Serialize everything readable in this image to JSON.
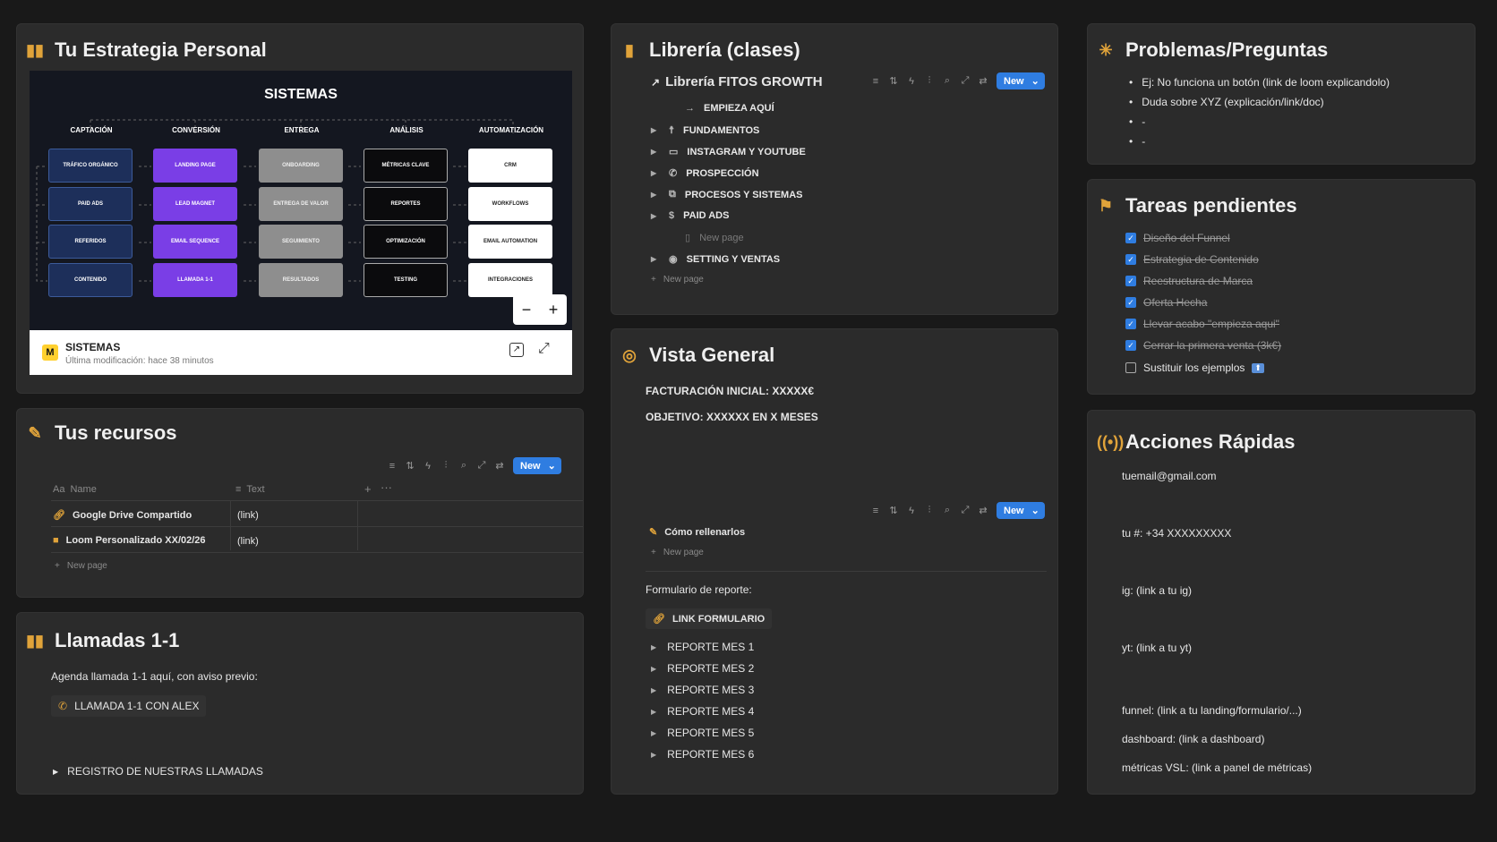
{
  "estrategia": {
    "title": "Tu Estrategia Personal",
    "diagram": {
      "title": "SISTEMAS",
      "columns": [
        "CAPTACIÓN",
        "CONVERSIÓN",
        "ENTREGA",
        "ANÁLISIS",
        "AUTOMATIZACIÓN"
      ],
      "boxes": [
        [
          "TRÁFICO ORGÁNICO",
          "PAID ADS",
          "REFERIDOS",
          "CONTENIDO"
        ],
        [
          "LANDING PAGE",
          "LEAD MAGNET",
          "EMAIL SEQUENCE",
          "LLAMADA 1-1"
        ],
        [
          "ONBOARDING",
          "ENTREGA DE VALOR",
          "SEGUIMIENTO",
          "RESULTADOS"
        ],
        [
          "MÉTRICAS CLAVE",
          "REPORTES",
          "OPTIMIZACIÓN",
          "TESTING"
        ],
        [
          "CRM",
          "WORKFLOWS",
          "EMAIL AUTOMATION",
          "INTEGRACIONES"
        ]
      ],
      "zoom_out": "−",
      "zoom_in": "+"
    },
    "footer": {
      "name": "SISTEMAS",
      "modified": "Última modificación: hace 38 minutos"
    }
  },
  "recursos": {
    "title": "Tus recursos",
    "new_label": "New",
    "col_name": "Name",
    "col_text": "Text",
    "rows": [
      {
        "name": "Google Drive Compartido",
        "text": "(link)"
      },
      {
        "name": "Loom Personalizado XX/02/26",
        "text": "(link)"
      }
    ],
    "new_page": "New page"
  },
  "llamadas": {
    "title": "Llamadas 1-1",
    "intro": "Agenda llamada 1-1 aquí, con aviso previo:",
    "button": "LLAMADA 1-1 CON ALEX",
    "toggle": "REGISTRO DE NUESTRAS LLAMADAS"
  },
  "libreria": {
    "title": "Librería (clases)",
    "db_title": "Librería FITOS GROWTH",
    "new_label": "New",
    "items": [
      {
        "label": "EMPIEZA AQUÍ",
        "toggle": false
      },
      {
        "label": "FUNDAMENTOS",
        "toggle": true
      },
      {
        "label": "INSTAGRAM Y YOUTUBE",
        "toggle": true
      },
      {
        "label": "PROSPECCIÓN",
        "toggle": true
      },
      {
        "label": "PROCESOS Y SISTEMAS",
        "toggle": true
      },
      {
        "label": "PAID ADS",
        "toggle": true
      }
    ],
    "new_page_inner": "New page",
    "item_last": "SETTING Y VENTAS",
    "new_page": "New page"
  },
  "vista": {
    "title": "Vista General",
    "facturacion": "FACTURACIÓN INICIAL: XXXXX€",
    "objetivo": "OBJETIVO: XXXXXX EN X MESES",
    "new_label": "New",
    "como": "Cómo rellenarlos",
    "new_page": "New page",
    "formulario_label": "Formulario de reporte:",
    "link_formulario": "LINK FORMULARIO",
    "reportes": [
      "REPORTE MES 1",
      "REPORTE MES 2",
      "REPORTE MES 3",
      "REPORTE MES 4",
      "REPORTE MES 5",
      "REPORTE MES 6"
    ]
  },
  "problemas": {
    "title": "Problemas/Preguntas",
    "bullets": [
      "Ej: No funciona un botón (link de loom explicandolo)",
      "Duda sobre XYZ (explicación/link/doc)",
      "-",
      "-"
    ]
  },
  "tareas": {
    "title": "Tareas pendientes",
    "items": [
      {
        "label": "Diseño del Funnel",
        "done": true
      },
      {
        "label": "Estrategia de Contenido",
        "done": true
      },
      {
        "label": "Reestructura de Marca",
        "done": true
      },
      {
        "label": "Oferta Hecha",
        "done": true
      },
      {
        "label": "Llevar acabo \"empieza aqui\"",
        "done": true
      },
      {
        "label": "Cerrar la primera venta (3k€)",
        "done": true
      },
      {
        "label": "Sustituir los ejemplos",
        "done": false
      }
    ]
  },
  "acciones": {
    "title": "Acciones Rápidas",
    "email": "tuemail@gmail.com",
    "phone": "tu #: +34 XXXXXXXXX",
    "ig": "ig: (link a tu ig)",
    "yt": "yt: (link a tu yt)",
    "funnel": "funnel: (link a tu landing/formulario/...)",
    "dashboard": "dashboard: (link a dashboard)",
    "metricas": "métricas VSL: (link a panel de métricas)"
  },
  "colors": {
    "accent": "#2f7de1",
    "icon": "#e0a33a",
    "card": "#2b2b2b",
    "bg": "#191919"
  }
}
